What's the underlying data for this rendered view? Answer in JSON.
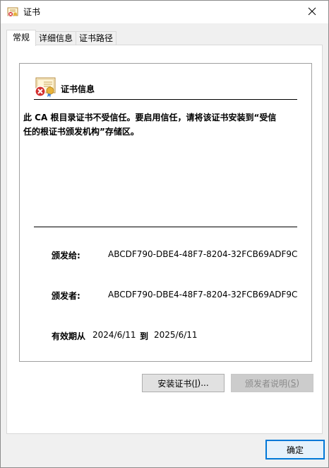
{
  "window": {
    "title": "证书"
  },
  "tabs": [
    {
      "label": "常规"
    },
    {
      "label": "详细信息"
    },
    {
      "label": "证书路径"
    }
  ],
  "cert_info": {
    "heading": "证书信息",
    "warning_line1": "此 CA 根目录证书不受信任。要启用信任，请将该证书安装到“受信",
    "warning_line2": "任的根证书颁发机构”存储区。",
    "issued_to_label": "颁发给:",
    "issued_to_value": "ABCDF790-DBE4-48F7-8204-32FCB69ADF9C",
    "issued_by_label": "颁发者:",
    "issued_by_value": "ABCDF790-DBE4-48F7-8204-32FCB69ADF9C",
    "validity_label": "有效期从",
    "valid_from": "2024/6/11",
    "to_label": "到",
    "valid_to": "2025/6/11"
  },
  "buttons": {
    "install_text": "安装证书(",
    "install_key": "I",
    "install_tail": ")...",
    "issuer_text": "颁发者说明(",
    "issuer_key": "S",
    "issuer_tail": ")",
    "ok_label": "确定"
  },
  "colors": {
    "accent": "#0078d7",
    "annotation_arrow": "#e02020",
    "error_red": "#d32f2f"
  },
  "icons": {
    "title": "certificate-error-icon",
    "close": "close-icon",
    "cert": "certificate-error-icon",
    "annotation": "red-arrow-icon"
  }
}
